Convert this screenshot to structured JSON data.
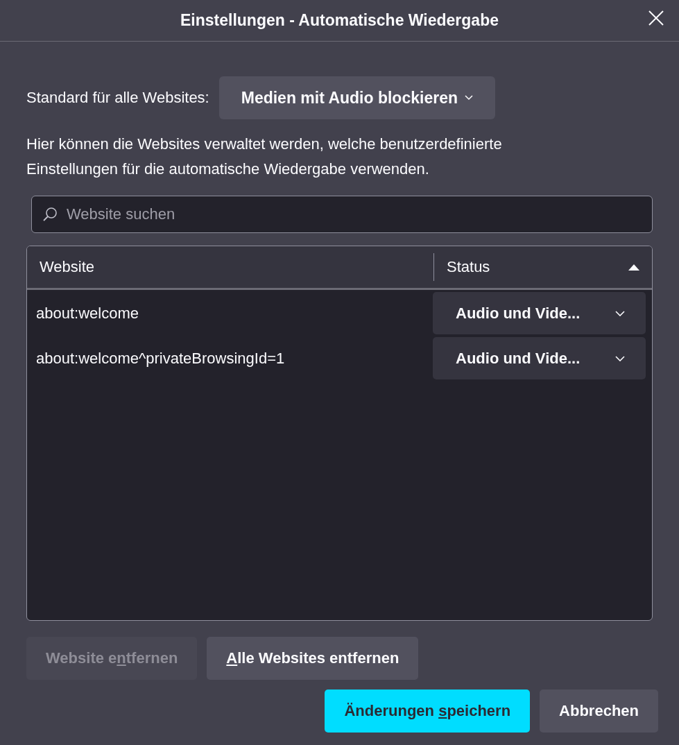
{
  "window": {
    "title": "Einstellungen - Automatische Wiedergabe"
  },
  "default_setting": {
    "label": "Standard für alle Websites:",
    "value": "Medien mit Audio blockieren"
  },
  "description": "Hier können die Websites verwaltet werden, welche benutzerdefinierte Einstellungen für die automatische Wiedergabe verwenden.",
  "search": {
    "placeholder": "Website suchen"
  },
  "table": {
    "columns": [
      {
        "label": "Website",
        "sorted": false
      },
      {
        "label": "Status",
        "sorted": true
      }
    ],
    "rows": [
      {
        "website": "about:welcome",
        "status": "Audio und Vide..."
      },
      {
        "website": "about:welcome^privateBrowsingId=1",
        "status": "Audio und Vide..."
      }
    ]
  },
  "list_buttons": [
    {
      "label_before": "Website e",
      "accesskey": "n",
      "label_after": "tfernen",
      "disabled": true
    },
    {
      "accesskey": "A",
      "label_after": "lle Websites entfernen",
      "disabled": false
    }
  ],
  "dialog_buttons": [
    {
      "label_before": "Änderungen ",
      "accesskey": "s",
      "label_after": "peichern",
      "primary": true
    },
    {
      "label_before": "Abbrechen",
      "primary": false
    }
  ]
}
